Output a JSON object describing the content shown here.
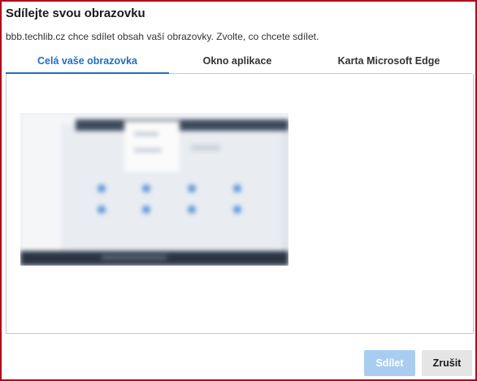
{
  "dialog": {
    "title": "Sdílejte svou obrazovku",
    "subtitle": "bbb.techlib.cz chce sdílet obsah vaší obrazovky. Zvolte, co chcete sdílet."
  },
  "tabs": [
    {
      "label": "Celá vaše obrazovka",
      "active": true
    },
    {
      "label": "Okno aplikace",
      "active": false
    },
    {
      "label": "Karta Microsoft Edge",
      "active": false
    }
  ],
  "buttons": {
    "share_label": "Sdílet",
    "share_enabled": false,
    "cancel_label": "Zrušit"
  },
  "colors": {
    "accent": "#1f6fbf",
    "frame_border": "#b3001b",
    "share_disabled": "#a9cdf0"
  }
}
